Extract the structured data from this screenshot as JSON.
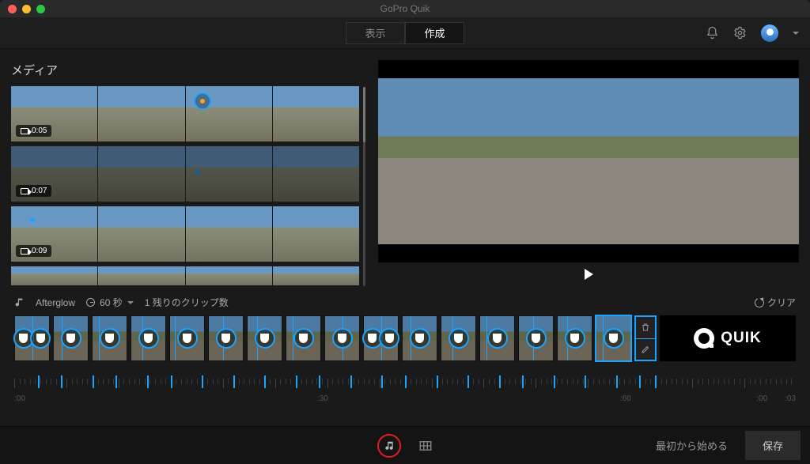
{
  "window": {
    "title": "GoPro Quik"
  },
  "header": {
    "tab_display": "表示",
    "tab_create": "作成"
  },
  "media": {
    "title": "メディア",
    "rows": [
      {
        "duration": "0:05"
      },
      {
        "duration": "0:07"
      },
      {
        "duration": "0:09"
      }
    ]
  },
  "timeline_header": {
    "song": "Afterglow",
    "length": "60 秒",
    "remaining": "1 残りのクリップ数",
    "clear": "クリア"
  },
  "quik": {
    "label": "QUIK"
  },
  "ruler": {
    "labels": [
      ":00",
      ":30",
      ":60",
      ":00",
      ":03"
    ]
  },
  "footer": {
    "restart": "最初から始める",
    "save": "保存"
  },
  "colors": {
    "accent": "#1aa3ff",
    "highlight_red": "#e31b23"
  }
}
